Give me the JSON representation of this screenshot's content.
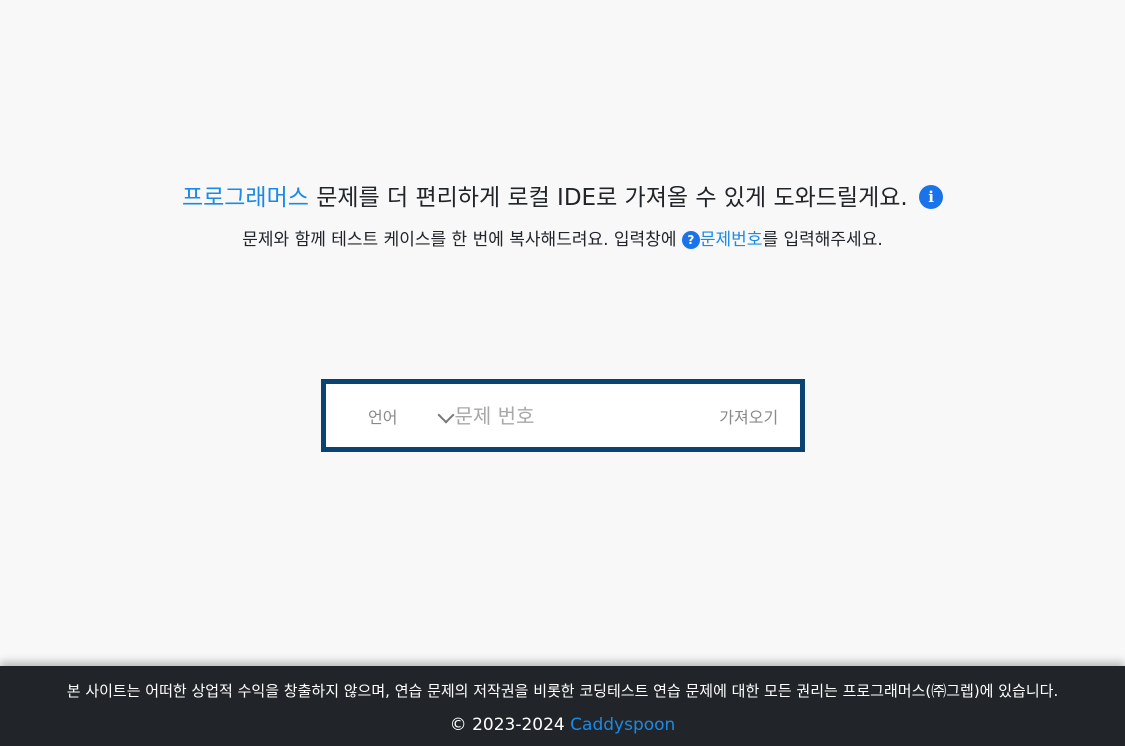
{
  "hero": {
    "link_text": "프로그래머스",
    "headline_rest": " 문제를 더 편리하게 로컬 IDE로 가져올 수 있게 도와드릴게요.",
    "info_icon_glyph": "i",
    "sub_before": "문제와 함께 테스트 케이스를 한 번에 복사해드려요. 입력창에 ",
    "sub_help_icon_glyph": "?",
    "sub_link": "문제번호",
    "sub_after": "를 입력해주세요."
  },
  "search": {
    "language_label": "언어",
    "problem_placeholder": "문제 번호",
    "fetch_label": "가져오기"
  },
  "footer": {
    "notice": "본 사이트는 어떠한 상업적 수익을 창출하지 않으며, 연습 문제의 저작권을 비롯한 코딩테스트 연습 문제에 대한 모든 권리는 프로그래머스(㈜그렙)에 있습니다.",
    "copyright": "© 2023-2024 ",
    "author": "Caddyspoon"
  },
  "colors": {
    "accent": "#1a8ae6",
    "search_border": "#0a4272",
    "footer_bg": "#212529",
    "page_bg": "#f8f8f8"
  },
  "icons": [
    "info-icon",
    "question-icon",
    "chevron-down-icon"
  ]
}
